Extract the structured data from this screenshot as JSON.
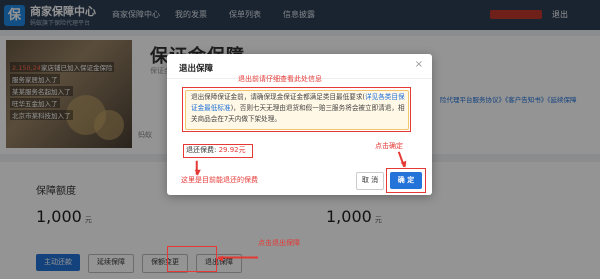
{
  "header": {
    "logo_char": "保",
    "app_title": "商家保障中心",
    "app_subtitle": "蚂蚁旗下保险代理平台",
    "nav": [
      "商家保障中心",
      "我的发票",
      "保单列表",
      "信息披露"
    ],
    "logout": "退出"
  },
  "page": {
    "title": "保证金保障",
    "subtitle": "保证金保",
    "right_links": "险代理平台服务协议》《客户告知书》《延续保障",
    "ant_tag": "蚂蚁",
    "photo_lines": [
      {
        "prefix": "2,150,24",
        "text": "家店铺已加入保证金保险"
      },
      {
        "prefix": "",
        "text": "服务家居加入了"
      },
      {
        "prefix": "",
        "text": "某某服务名起加入了"
      },
      {
        "prefix": "",
        "text": "旺华五金加入了"
      },
      {
        "prefix": "",
        "text": "北京市某科技加入了"
      }
    ]
  },
  "quota": {
    "label": "保障额度",
    "amount_left": "1,000",
    "amount_right": "1,000",
    "unit": "元"
  },
  "buttons": [
    "主动还款",
    "延续保障",
    "保额变更",
    "退出保障"
  ],
  "dialog": {
    "title": "退出保障",
    "close": "×",
    "notice_before": "退出保障保证金前，请确保现金保证金都满足类目最低要求(",
    "notice_link": "详见各类目保证金最低标准",
    "notice_after": ")，否则七天无理由退货和假一赔三服务将会被立即清退，相关商品会在7天内做下架处理。",
    "refund_label": "退还保费:",
    "refund_amount": "29.92元",
    "cancel": "取 消",
    "confirm": "确 定"
  },
  "annotations": {
    "read_carefully": "退出前请仔细查看此处信息",
    "click_confirm": "点击确定",
    "refund_fee": "这里是目前能退还的保费",
    "click_exit": "点击退出保障"
  },
  "colors": {
    "nav_bg": "#2d3e55",
    "primary": "#2473d8",
    "annotation": "#e53935"
  }
}
